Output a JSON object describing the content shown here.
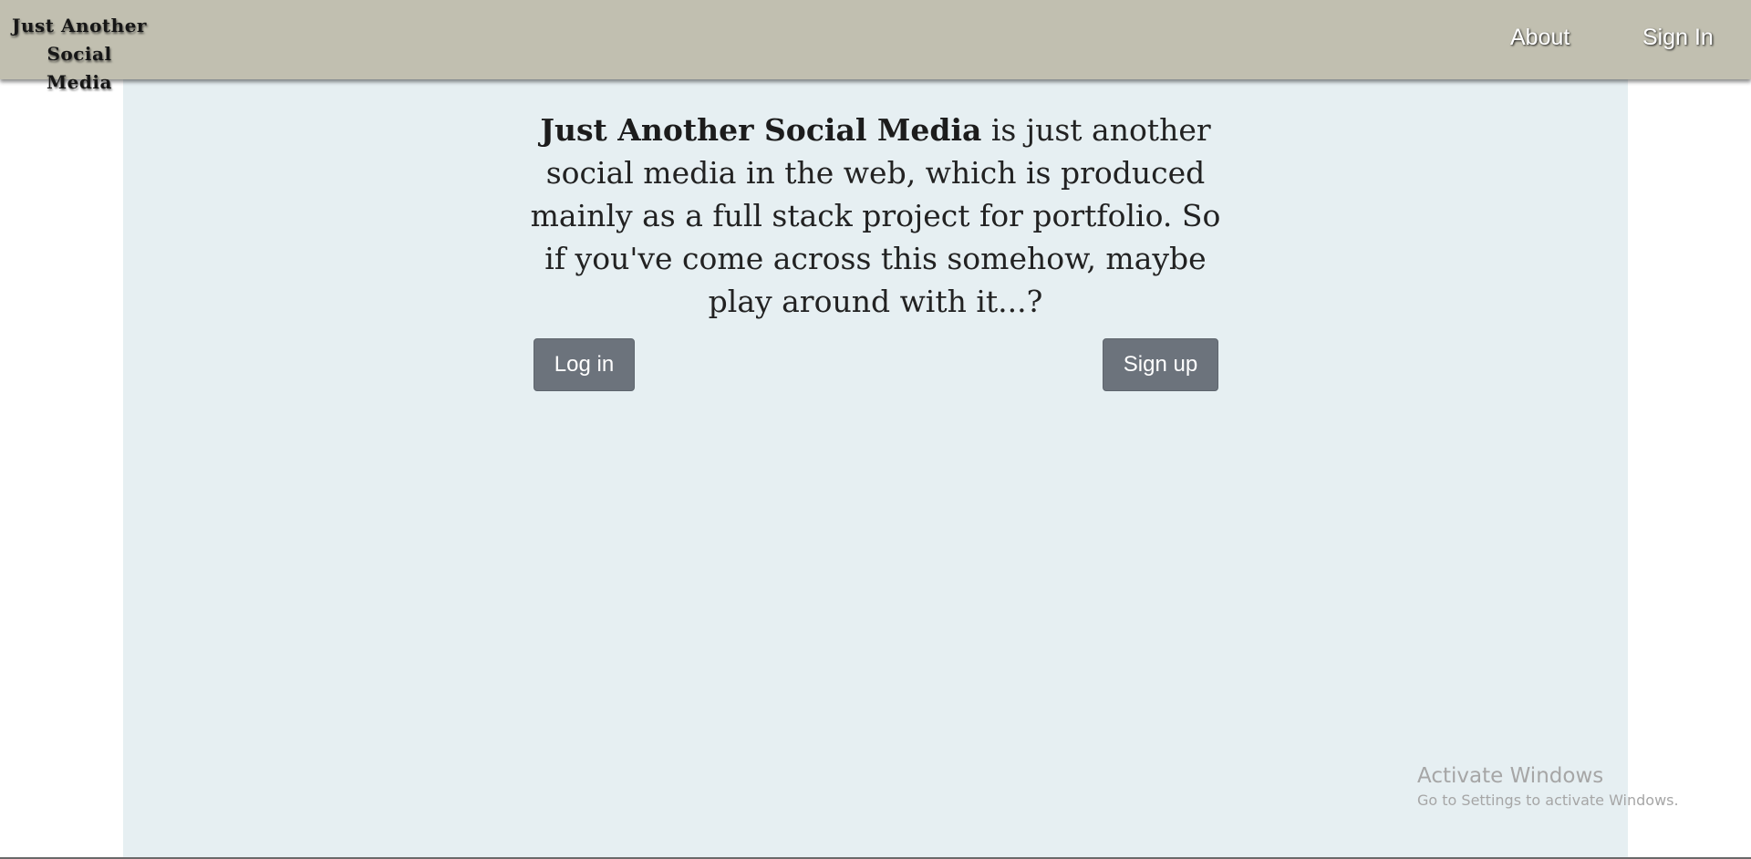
{
  "navbar": {
    "brand_line1": "Just Another",
    "brand_line2": "Social Media",
    "links": [
      {
        "label": "About"
      },
      {
        "label": "Sign In"
      }
    ]
  },
  "intro": {
    "brand_name": "Just Another Social Media",
    "text": " is just another social media in the web, which is produced mainly as a full stack project for portfolio. So if you've come across this somehow, maybe play around with it...?"
  },
  "actions": {
    "login_label": "Log in",
    "signup_label": "Sign up"
  },
  "watermark": {
    "title": "Activate Windows",
    "subtitle": "Go to Settings to activate Windows."
  },
  "colors": {
    "navbar_bg": "#c1bfb0",
    "main_bg": "#e6eff2",
    "button_bg": "#6c737c"
  }
}
